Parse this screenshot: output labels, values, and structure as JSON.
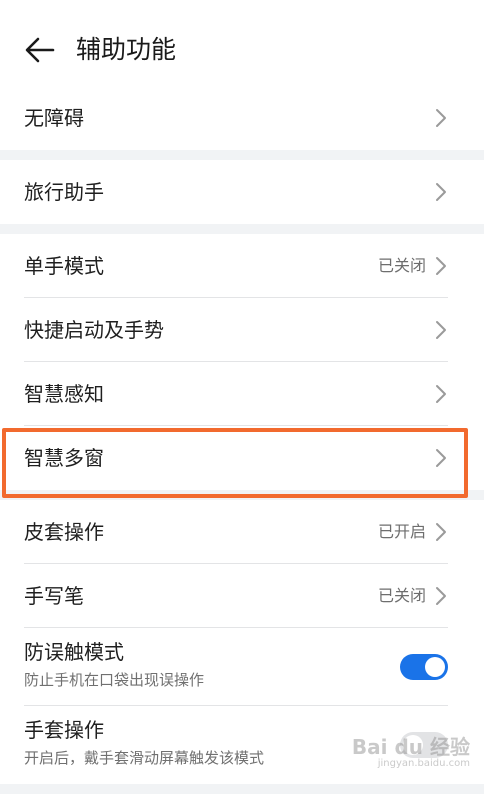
{
  "header": {
    "title": "辅助功能"
  },
  "groups": [
    {
      "items": [
        {
          "label": "无障碍",
          "status": ""
        }
      ]
    },
    {
      "items": [
        {
          "label": "旅行助手",
          "status": ""
        }
      ]
    },
    {
      "items": [
        {
          "label": "单手模式",
          "status": "已关闭"
        },
        {
          "label": "快捷启动及手势",
          "status": ""
        },
        {
          "label": "智慧感知",
          "status": ""
        },
        {
          "label": "智慧多窗",
          "status": ""
        }
      ]
    },
    {
      "items": [
        {
          "label": "皮套操作",
          "status": "已开启"
        },
        {
          "label": "手写笔",
          "status": "已关闭"
        },
        {
          "label": "防误触模式",
          "subtitle": "防止手机在口袋出现误操作",
          "toggle": true
        },
        {
          "label": "手套操作",
          "subtitle": "开启后，戴手套滑动屏幕触发该模式",
          "toggle": false
        }
      ]
    }
  ],
  "watermark": {
    "main": "Bai du 经验",
    "sub": "jingyan.baidu.com"
  },
  "colors": {
    "accent": "#1a73e8",
    "highlight": "#f26a2e"
  },
  "icons": {
    "back": "arrow-left-icon",
    "chevron": "chevron-right-icon"
  }
}
